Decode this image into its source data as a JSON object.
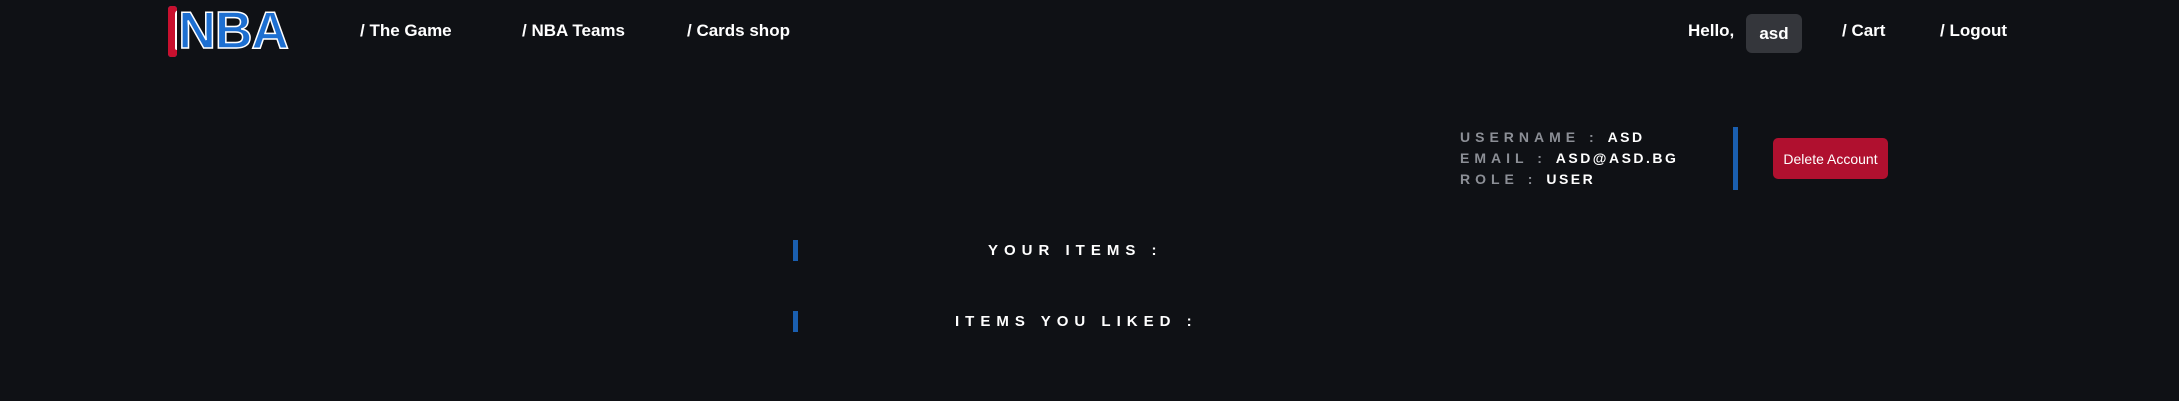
{
  "header": {
    "logo_text": "NBA",
    "nav": {
      "the_game": "/ The Game",
      "nba_teams": "/ NBA Teams",
      "cards_shop": "/ Cards shop",
      "cart": "/ Cart",
      "logout": "/ Logout"
    },
    "greeting": "Hello,",
    "username_chip": "asd"
  },
  "profile": {
    "username_label": "USERNAME :",
    "username_value": "ASD",
    "email_label": "EMAIL :",
    "email_value": "ASD@ASD.BG",
    "role_label": "ROLE :",
    "role_value": "USER",
    "delete_button": "Delete Account"
  },
  "sections": {
    "your_items": "YOUR ITEMS :",
    "items_liked": "ITEMS YOU LIKED :"
  },
  "colors": {
    "background": "#0f1115",
    "accent_blue": "#1a5fb0",
    "danger_red": "#b0102f",
    "chip_bg": "#34363b",
    "muted_label": "#8c8f96"
  }
}
